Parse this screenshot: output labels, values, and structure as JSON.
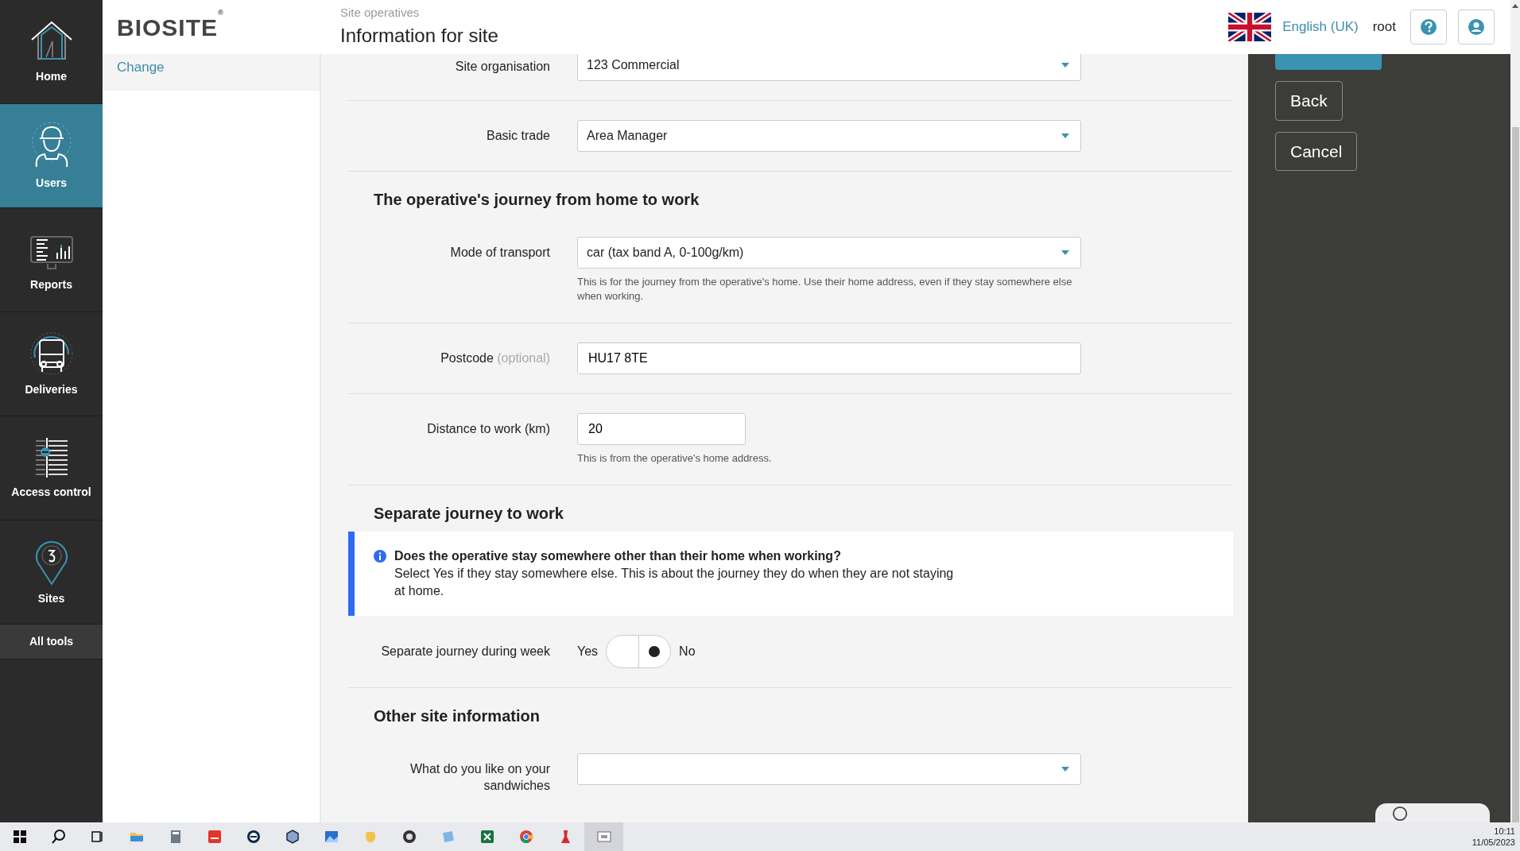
{
  "sidebar": {
    "items": [
      {
        "kind": "home",
        "label": "Home",
        "selected": false
      },
      {
        "kind": "users",
        "label": "Users",
        "selected": true
      },
      {
        "kind": "reports",
        "label": "Reports",
        "selected": false
      },
      {
        "kind": "deliveries",
        "label": "Deliveries",
        "selected": false
      },
      {
        "kind": "access",
        "label": "Access control",
        "selected": false
      },
      {
        "kind": "sites",
        "label": "Sites",
        "selected": false
      }
    ],
    "all_tools": "All tools"
  },
  "header": {
    "logo": "BIOSITE",
    "logo_mark": "®",
    "breadcrumb": "Site operatives",
    "title": "Information for site",
    "language": "English (UK)",
    "user": "root"
  },
  "left_panel": {
    "link": "Change"
  },
  "form": {
    "rows": [
      {
        "kind": "select",
        "label": "Site organisation",
        "value": "123 Commercial"
      },
      {
        "kind": "select",
        "label": "Basic trade",
        "value": "Area Manager"
      },
      {
        "kind": "heading",
        "text": "The operative's journey from home to work"
      },
      {
        "kind": "select",
        "label": "Mode of transport",
        "value": "car (tax band A, 0-100g/km)",
        "help": "This is for the journey from the operative's home. Use their home address, even if they stay somewhere else when working."
      },
      {
        "kind": "text",
        "label": "Postcode",
        "note": "(optional)",
        "value": "HU17 8TE"
      },
      {
        "kind": "text",
        "label": "Distance to work (km)",
        "value": "20",
        "short": true,
        "help": "This is from the operative's home address."
      },
      {
        "kind": "heading",
        "text": "Separate journey to work"
      },
      {
        "kind": "alert",
        "title": "Does the operative stay somewhere other than their home when working?",
        "text": "Select Yes if they stay somewhere else. This is about the journey they do when they are not staying at home."
      },
      {
        "kind": "toggle",
        "label": "Separate journey during week",
        "yes": "Yes",
        "no": "No",
        "on": false
      },
      {
        "kind": "heading",
        "text": "Other site information"
      },
      {
        "kind": "select",
        "label": "What do you like on your sandwiches"
      }
    ]
  },
  "actions": {
    "buttons": [
      {
        "label": "Back"
      },
      {
        "label": "Cancel"
      }
    ]
  },
  "taskbar": {
    "time": "10:11",
    "date": "11/05/2023"
  }
}
